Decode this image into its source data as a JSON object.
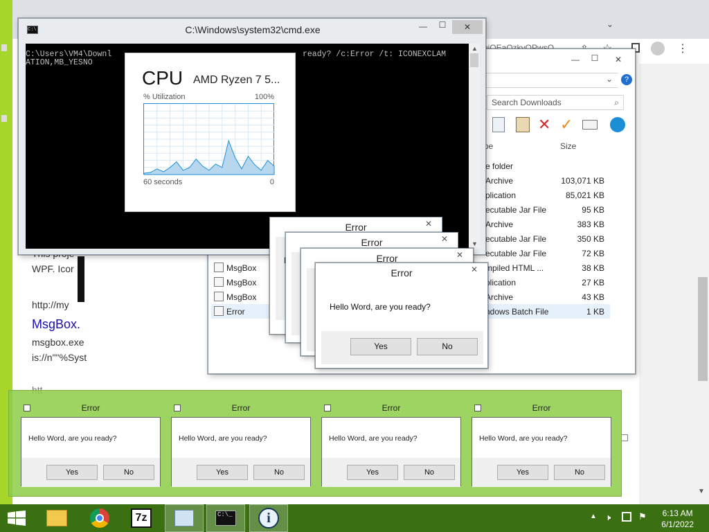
{
  "desktop_top_right_buttons": {
    "minimize": "—",
    "maximize": "☐",
    "close": "✕"
  },
  "chrome": {
    "url_fragment": "uiQEaQzkyQPwsQ",
    "page_lines": [
      "This proje",
      "WPF. Icor",
      "http://my",
      "MsgBox.",
      "msgbox.exe",
      "is://n\"\"%Syst",
      "htt"
    ]
  },
  "explorer": {
    "search_placeholder": "Search Downloads",
    "columns": {
      "type": "pe",
      "size": "Size"
    },
    "rows": [
      {
        "name": "",
        "type": "e folder",
        "size": ""
      },
      {
        "name": "",
        "type": "Archive",
        "size": "103,071 KB"
      },
      {
        "name": "",
        "type": "plication",
        "size": "85,021 KB"
      },
      {
        "name": "",
        "type": "ecutable Jar File",
        "size": "95 KB"
      },
      {
        "name": "",
        "type": "Archive",
        "size": "383 KB"
      },
      {
        "name": "",
        "type": "ecutable Jar File",
        "size": "350 KB"
      },
      {
        "name": "",
        "type": "ecutable Jar File",
        "size": "72 KB"
      },
      {
        "name": "MsgBox",
        "type": "mpiled HTML ...",
        "size": "38 KB"
      },
      {
        "name": "MsgBox",
        "type": "plication",
        "size": "27 KB"
      },
      {
        "name": "MsgBox",
        "type": "Archive",
        "size": "43 KB"
      },
      {
        "name": "Error",
        "type": "ndows Batch File",
        "size": "1 KB"
      }
    ]
  },
  "cmd": {
    "title": "C:\\Windows\\system32\\cmd.exe",
    "line1_left": "C:\\Users\\VM4\\Downl",
    "line1_right": "ready? /c:Error /t: ICONEXCLAM",
    "line2": "ATION,MB_YESNO"
  },
  "cpu": {
    "title": "CPU",
    "model": "AMD Ryzen 7 5...",
    "util_label": "% Utilization",
    "max_label": "100%",
    "time_label": "60 seconds",
    "min_label": "0",
    "chart_data": {
      "type": "area",
      "title": "",
      "xlabel": "60 seconds",
      "ylabel": "% Utilization",
      "ylim": [
        0,
        100
      ],
      "xlim": [
        60,
        0
      ],
      "x": [
        60,
        57,
        54,
        51,
        48,
        45,
        42,
        39,
        36,
        33,
        30,
        27,
        24,
        21,
        18,
        15,
        12,
        9,
        6,
        3,
        0
      ],
      "values": [
        2,
        3,
        8,
        4,
        10,
        18,
        6,
        10,
        22,
        12,
        6,
        15,
        10,
        48,
        24,
        8,
        26,
        14,
        6,
        20,
        12
      ]
    }
  },
  "dialog": {
    "title": "Error",
    "message": "Hello Word, are you ready?",
    "yes": "Yes",
    "no": "No",
    "close": "✕"
  },
  "thumbnails": [
    {
      "title": "Error",
      "message": "Hello Word, are you ready?",
      "yes": "Yes",
      "no": "No"
    },
    {
      "title": "Error",
      "message": "Hello Word, are you ready?",
      "yes": "Yes",
      "no": "No"
    },
    {
      "title": "Error",
      "message": "Hello Word, are you ready?",
      "yes": "Yes",
      "no": "No"
    },
    {
      "title": "Error",
      "message": "Hello Word, are you ready?",
      "yes": "Yes",
      "no": "No"
    }
  ],
  "taskbar": {
    "time": "6:13 AM",
    "date": "6/1/2022",
    "items": [
      "start",
      "file-explorer",
      "chrome",
      "7zip",
      "task-manager",
      "cmd",
      "msgbox"
    ]
  }
}
